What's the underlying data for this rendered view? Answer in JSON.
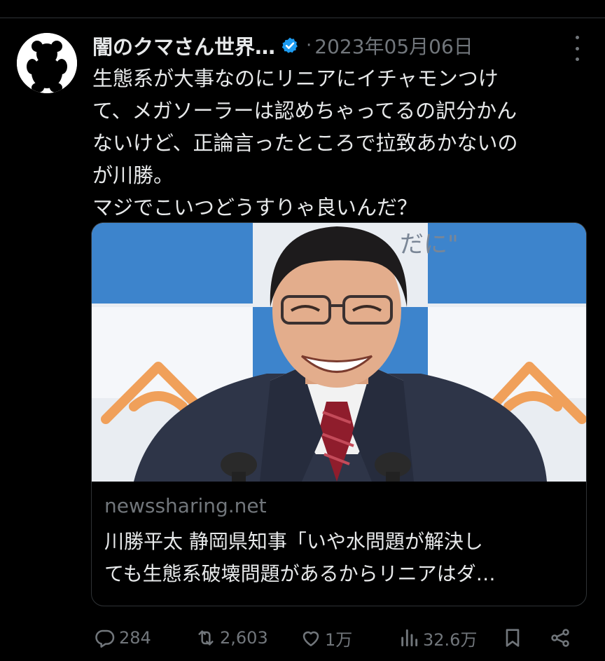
{
  "tweet": {
    "author": {
      "display_name": "闇のクマさん世界…",
      "verified": true,
      "avatar_icon": "bear-silhouette-icon"
    },
    "separator": "·",
    "date": "2023年05月06日",
    "text_lines": [
      "生態系が大事なのにリニアにイチャモンつけ",
      "て、メガソーラーは認めちゃってるの訳分かん",
      "ないけど、正論言ったところで拉致あかないの",
      "が川勝。",
      "マジでこいつどうすりゃ良いんだ？"
    ],
    "card": {
      "image_icon": "news-photo-smiling-man-in-suit",
      "backdrop_text": "だに\"",
      "domain": "newssharing.net",
      "title_lines": [
        "川勝平太 静岡県知事「いや水問題が解決し",
        "ても生態系破壊問題があるからリニアはダ…"
      ]
    },
    "actions": {
      "replies": "284",
      "retweets": "2,603",
      "likes": "1万",
      "views": "32.6万"
    }
  },
  "colors": {
    "background": "#000000",
    "text": "#e7e9ea",
    "muted": "#71767b",
    "border": "#2f3336",
    "verified": "#1d9bf0",
    "card_backdrop_blue": "#3d84cc",
    "card_logo_orange": "#f0a05a"
  }
}
